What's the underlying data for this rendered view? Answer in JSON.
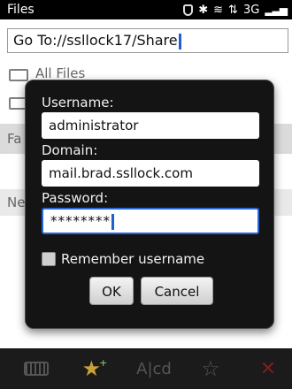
{
  "status_bar": {
    "app_title": "Files",
    "network_label": "3G",
    "icons": [
      "shield-icon",
      "bluetooth-icon",
      "wifi-icon",
      "data-transfer-icon",
      "signal-icon"
    ]
  },
  "address_bar": {
    "value": "Go To://ssllock17/Share"
  },
  "background_list": {
    "row1_label": "All Files",
    "favorites_header": "Fa",
    "new_header": "Ne"
  },
  "dialog": {
    "username_label": "Username:",
    "username_value": "administrator",
    "domain_label": "Domain:",
    "domain_value": "mail.brad.ssllock.com",
    "password_label": "Password:",
    "password_value": "********",
    "remember_label": "Remember username",
    "remember_checked": false,
    "ok_label": "OK",
    "cancel_label": "Cancel"
  },
  "toolbar": {
    "rename_label": "A|cd",
    "icons": [
      "keyboard-icon",
      "add-favorite-icon",
      "rename-icon",
      "remove-favorite-icon",
      "delete-icon"
    ]
  },
  "colors": {
    "accent": "#2a67d6",
    "dialog_bg": "#141414"
  }
}
